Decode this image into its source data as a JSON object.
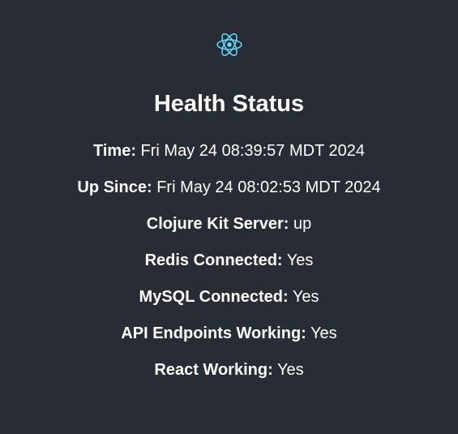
{
  "colors": {
    "background": "#282c34",
    "text": "#ffffff",
    "logo": "#61dafb"
  },
  "logo": {
    "icon": "react-atom-icon"
  },
  "title": "Health Status",
  "rows": [
    {
      "label": "Time:",
      "value": "Fri May 24 08:39:57 MDT 2024"
    },
    {
      "label": "Up Since:",
      "value": "Fri May 24 08:02:53 MDT 2024"
    },
    {
      "label": "Clojure Kit Server:",
      "value": "up"
    },
    {
      "label": "Redis Connected:",
      "value": "Yes"
    },
    {
      "label": "MySQL Connected:",
      "value": "Yes"
    },
    {
      "label": "API Endpoints Working:",
      "value": "Yes"
    },
    {
      "label": "React Working:",
      "value": "Yes"
    }
  ]
}
